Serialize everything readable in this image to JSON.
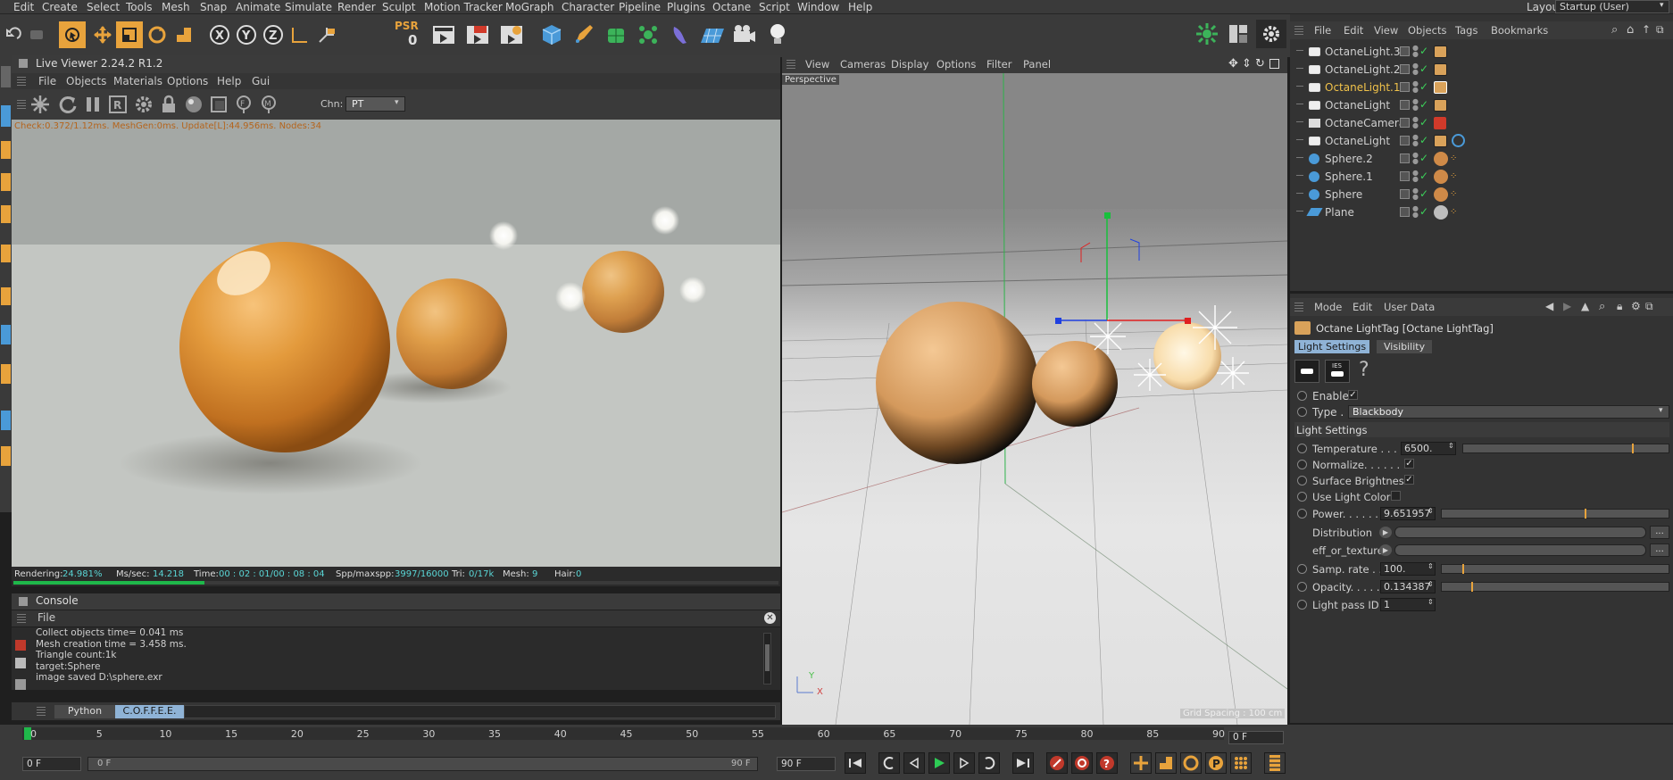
{
  "menubar": {
    "items": [
      "Edit",
      "Create",
      "Select",
      "Tools",
      "Mesh",
      "Snap",
      "Animate",
      "Simulate",
      "Render",
      "Sculpt",
      "Motion Tracker",
      "MoGraph",
      "Character",
      "Pipeline",
      "Plugins",
      "Octane",
      "Script",
      "Window",
      "Help"
    ],
    "layout_label": "Layout:",
    "layout_value": "Startup (User)"
  },
  "toolbar": {
    "psr_label": "PSR",
    "psr_value": "0",
    "icons": [
      "undo-icon",
      "redo-icon",
      "select-cursor-icon",
      "move-icon",
      "scale-icon",
      "rotate-icon",
      "recent-tool-icon",
      "x-axis-icon",
      "y-axis-icon",
      "z-axis-icon",
      "world-coordinate-icon",
      "coordinate-system-icon",
      "render-view-icon",
      "render-picture-viewer-icon",
      "edit-render-settings-icon",
      "cube-icon",
      "pen-icon",
      "subdivision-icon",
      "cloner-icon",
      "deformer-icon",
      "floor-icon",
      "camera-icon",
      "light-icon"
    ]
  },
  "live_viewer": {
    "title": "Live Viewer 2.24.2 R1.2",
    "menu": [
      "File",
      "Objects",
      "Materials",
      "Options",
      "Help",
      "Gui"
    ],
    "channel_label": "Chn:",
    "channel_value": "PT",
    "status_line": "Check:0.372/1.12ms. MeshGen:0ms. Update[L]:44.956ms. Nodes:34",
    "stats": {
      "rendering_label": "Rendering:",
      "rendering_value": "24.981%",
      "mssec_label": "Ms/sec:",
      "mssec_value": "14.218",
      "time_label": "Time:",
      "time_value": "00 : 02 : 01/00 : 08 : 04",
      "spp_label": "Spp/maxspp:",
      "spp_value": "3997/16000",
      "tri_label": "Tri:",
      "tri_value": "0/17k",
      "mesh_label": "Mesh:",
      "mesh_value": "9",
      "hair_label": "Hair:",
      "hair_value": "0"
    },
    "progress": 0.2498
  },
  "console": {
    "title": "Console",
    "menu_file": "File",
    "lines": [
      "Collect objects time= 0.041 ms",
      "Mesh creation time = 3.458 ms.",
      "Triangle count:1k",
      "target:Sphere",
      "image saved D:\\sphere.exr"
    ],
    "tabs": [
      "Python",
      "C.O.F.F.E.E."
    ]
  },
  "viewport": {
    "menu": [
      "View",
      "Cameras",
      "Display",
      "Options",
      "Filter",
      "Panel"
    ],
    "label": "Perspective",
    "grid_spacing": "Grid Spacing : 100 cm",
    "axis_x": "X",
    "axis_y": "Y"
  },
  "object_manager": {
    "menu": [
      "File",
      "Edit",
      "View",
      "Objects",
      "Tags",
      "Bookmarks"
    ],
    "objects": [
      {
        "name": "OctaneLight.3",
        "selected": false
      },
      {
        "name": "OctaneLight.2",
        "selected": false
      },
      {
        "name": "OctaneLight.1",
        "selected": true
      },
      {
        "name": "OctaneLight",
        "selected": false
      },
      {
        "name": "OctaneCamera",
        "selected": false
      },
      {
        "name": "OctaneLight",
        "selected": false
      },
      {
        "name": "Sphere.2",
        "selected": false
      },
      {
        "name": "Sphere.1",
        "selected": false
      },
      {
        "name": "Sphere",
        "selected": false
      },
      {
        "name": "Plane",
        "selected": false
      }
    ]
  },
  "attributes": {
    "menu": [
      "Mode",
      "Edit",
      "User Data"
    ],
    "tag_title": "Octane LightTag [Octane LightTag]",
    "tabs": [
      "Light Settings",
      "Visibility"
    ],
    "help_glyph": "?",
    "enable_label": "Enable",
    "type_label": "Type . .",
    "type_value": "Blackbody",
    "section_title": "Light Settings",
    "temperature_label": "Temperature . . . . .",
    "temperature_value": "6500.",
    "temperature_fraction": 0.82,
    "normalize_label": "Normalize. . . . . . . .",
    "surface_brightness_label": "Surface Brightness",
    "use_light_color_label": "Use Light Color",
    "power_label": "Power. . . . . . . .",
    "power_value": "9.651957",
    "power_fraction": 0.63,
    "distribution_label": "Distribution",
    "eff_label": "eff_or_texture",
    "samp_rate_label": "Samp. rate . . .",
    "samp_rate_value": "100.",
    "samp_rate_fraction": 0.09,
    "opacity_label": "Opacity. . . . . .",
    "opacity_value": "0.134387",
    "opacity_fraction": 0.13,
    "light_pass_label": "Light pass ID",
    "light_pass_value": "1",
    "more_button": "..."
  },
  "timeline": {
    "ticks": [
      "0",
      "5",
      "10",
      "15",
      "20",
      "25",
      "30",
      "35",
      "40",
      "45",
      "50",
      "55",
      "60",
      "65",
      "70",
      "75",
      "80",
      "85",
      "90"
    ],
    "current_frame_right": "0 F",
    "start_frame": "0 F",
    "range_start": "0 F",
    "range_end": "90 F",
    "end_frame": "90 F"
  },
  "colors": {
    "accent_orange": "#e8a33c",
    "selected_text": "#f0c24a",
    "progress_green": "#1fb84a",
    "panel_bg": "#3a3a3a",
    "dark_bg": "#1f1f1f"
  }
}
